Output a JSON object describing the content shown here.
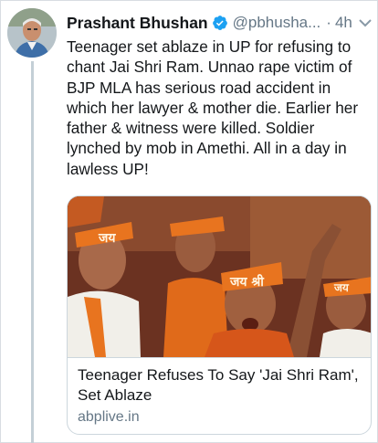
{
  "tweet": {
    "author_name": "Prashant Bhushan",
    "handle": "@pbhusha...",
    "separator": "·",
    "time": "4h",
    "text": "Teenager set ablaze in UP for refusing to chant Jai Shri Ram. Unnao rape victim of BJP MLA has serious road accident in which her lawyer & mother die. Earlier her father & witness were killed. Soldier lynched by mob in Amethi. All in a day in lawless UP!"
  },
  "card": {
    "title": "Teenager Refuses To Say 'Jai Shri Ram', Set Ablaze",
    "domain": "abplive.in",
    "image_text_left": "जय",
    "image_text_center": "जय श्री",
    "image_text_right": "जय"
  },
  "colors": {
    "verified": "#1da1f2",
    "secondary_text": "#657786",
    "saffron": "#e8741f"
  }
}
